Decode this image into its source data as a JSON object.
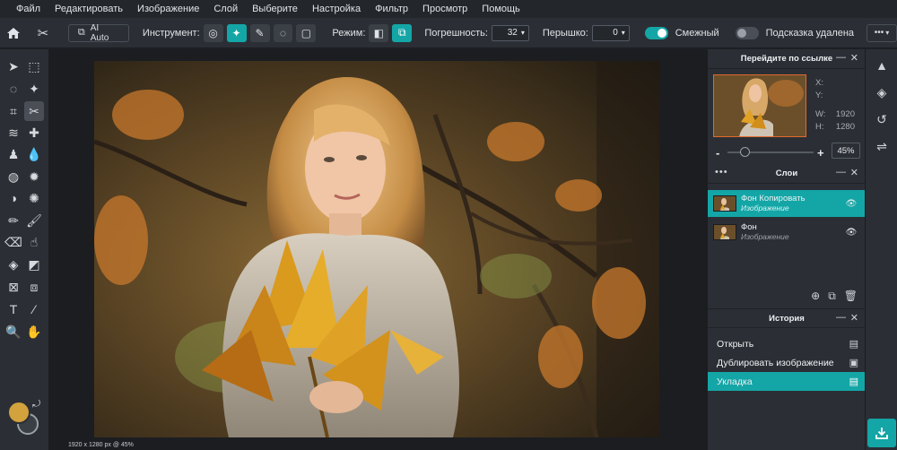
{
  "menu": [
    "Файл",
    "Редактировать",
    "Изображение",
    "Слой",
    "Выберите",
    "Настройка",
    "Фильтр",
    "Просмотр",
    "Помощь"
  ],
  "options": {
    "ai_auto": "AI Auto",
    "instrument_label": "Инструмент:",
    "mode_label": "Режим:",
    "tolerance_label": "Погрешность:",
    "tolerance_value": "32",
    "feather_label": "Перышко:",
    "feather_value": "0",
    "contiguous_label": "Смежный",
    "contiguous_on": true,
    "delete_hint_label": "Подсказка удалена",
    "delete_hint_on": false,
    "more": "•••"
  },
  "navigator": {
    "title": "Перейдите по ссылке",
    "x_label": "X:",
    "y_label": "Y:",
    "w_label": "W:",
    "w_value": "1920",
    "h_label": "H:",
    "h_value": "1280",
    "zoom_minus": "-",
    "zoom_plus": "+",
    "zoom_value": "45%"
  },
  "layers": {
    "title": "Слои",
    "items": [
      {
        "name": "Фон Копировать",
        "type": "Изображение",
        "selected": true
      },
      {
        "name": "Фон",
        "type": "Изображение",
        "selected": false
      }
    ]
  },
  "history": {
    "title": "История",
    "items": [
      {
        "label": "Открыть",
        "selected": false
      },
      {
        "label": "Дублировать изображение",
        "selected": false
      },
      {
        "label": "Укладка",
        "selected": true
      }
    ]
  },
  "status": "1920 x 1280 px @ 45%",
  "colors": {
    "accent": "#14a6a6",
    "foreground": "#d2a23c",
    "background": "#3a3e45"
  }
}
